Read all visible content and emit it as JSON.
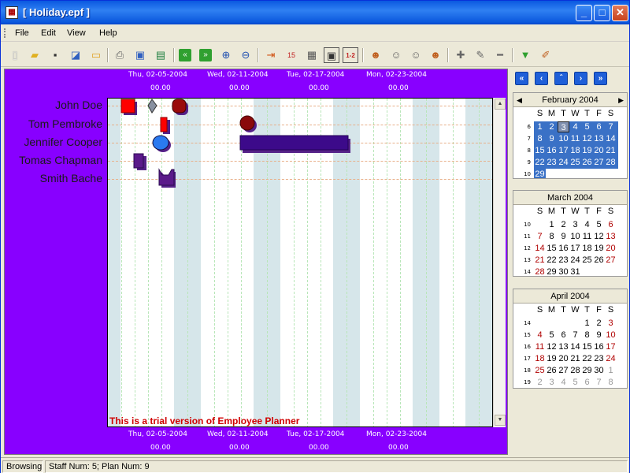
{
  "window": {
    "title": "[ Holiday.epf ]",
    "minimize_glyph": "_",
    "maximize_glyph": "□",
    "close_glyph": "✕"
  },
  "menu": {
    "items": [
      "File",
      "Edit",
      "View",
      "Help"
    ]
  },
  "toolbar": {
    "icons": [
      "new-icon",
      "open-icon",
      "save-icon",
      "save-as-icon",
      "folder-icon",
      "print-icon",
      "print-preview-icon",
      "page-setup-icon",
      "prev-icon",
      "next-icon",
      "zoom-in-icon",
      "zoom-out-icon",
      "insert-row-icon",
      "calendar-day-icon",
      "calendar-week-icon",
      "calendar-month-icon",
      "calendar-range-icon",
      "add-staff-icon",
      "staff-properties-icon",
      "delete-staff-icon",
      "staff-group-icon",
      "add-plan-icon",
      "edit-plan-icon",
      "delete-plan-icon",
      "filter-icon",
      "clear-icon"
    ]
  },
  "planner": {
    "header_dates": [
      "Thu, 02-05-2004",
      "Wed, 02-11-2004",
      "Tue, 02-17-2004",
      "Mon, 02-23-2004"
    ],
    "header_times": [
      "00.00",
      "00.00",
      "00.00",
      "00.00"
    ],
    "footer_dates": [
      "Thu, 02-05-2004",
      "Wed, 02-11-2004",
      "Tue, 02-17-2004",
      "Mon, 02-23-2004"
    ],
    "footer_times": [
      "00.00",
      "00.00",
      "00.00",
      "00.00"
    ],
    "staff": [
      "John Doe",
      "Tom Pembroke",
      "Jennifer Cooper",
      "Tomas Chapman",
      "Smith Bache"
    ],
    "trial_notice": "This is a trial version of Employee Planner",
    "background_color": "#8800FF"
  },
  "calendars": [
    {
      "title": "February 2004",
      "weeks": [
        "6",
        "7",
        "8",
        "9",
        "10"
      ],
      "days": [
        [
          "1",
          "2",
          "3",
          "4",
          "5",
          "6",
          "7"
        ],
        [
          "8",
          "9",
          "10",
          "11",
          "12",
          "13",
          "14"
        ],
        [
          "15",
          "16",
          "17",
          "18",
          "19",
          "20",
          "21"
        ],
        [
          "22",
          "23",
          "24",
          "25",
          "26",
          "27",
          "28"
        ],
        [
          "29",
          "",
          "",
          "",
          "",
          "",
          ""
        ]
      ]
    },
    {
      "title": "March 2004",
      "weeks": [
        "10",
        "11",
        "12",
        "13",
        "14"
      ],
      "days": [
        [
          "",
          "1",
          "2",
          "3",
          "4",
          "5",
          "6"
        ],
        [
          "7",
          "8",
          "9",
          "10",
          "11",
          "12",
          "13"
        ],
        [
          "14",
          "15",
          "16",
          "17",
          "18",
          "19",
          "20"
        ],
        [
          "21",
          "22",
          "23",
          "24",
          "25",
          "26",
          "27"
        ],
        [
          "28",
          "29",
          "30",
          "31",
          "",
          "",
          ""
        ]
      ]
    },
    {
      "title": "April 2004",
      "weeks": [
        "14",
        "15",
        "16",
        "17",
        "18",
        "19"
      ],
      "days": [
        [
          "",
          "",
          "",
          "",
          "1",
          "2",
          "3"
        ],
        [
          "4",
          "5",
          "6",
          "7",
          "8",
          "9",
          "10"
        ],
        [
          "11",
          "12",
          "13",
          "14",
          "15",
          "16",
          "17"
        ],
        [
          "18",
          "19",
          "20",
          "21",
          "22",
          "23",
          "24"
        ],
        [
          "25",
          "26",
          "27",
          "28",
          "29",
          "30",
          "1"
        ],
        [
          "2",
          "3",
          "4",
          "5",
          "6",
          "7",
          "8"
        ]
      ]
    }
  ],
  "weekday_headers": [
    "S",
    "M",
    "T",
    "W",
    "T",
    "F",
    "S"
  ],
  "nav_buttons": [
    "«",
    "‹",
    "ˆ",
    "›",
    "»"
  ],
  "status": {
    "mode": "Browsing",
    "counts": "Staff Num: 5; Plan Num: 9"
  },
  "colors": {
    "accent": "#3A71C6",
    "sunday_red": "#B00000"
  }
}
